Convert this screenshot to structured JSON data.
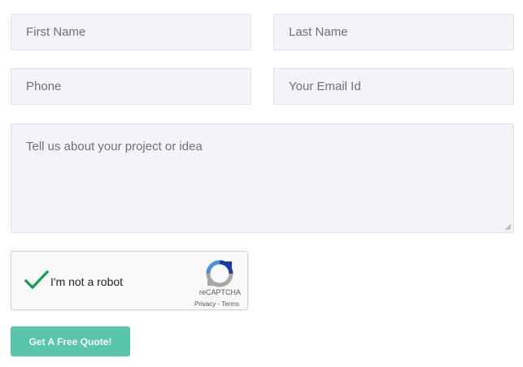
{
  "form": {
    "first_name_placeholder": "First Name",
    "last_name_placeholder": "Last Name",
    "phone_placeholder": "Phone",
    "email_placeholder": "Your Email Id",
    "message_placeholder": "Tell us about your project or idea"
  },
  "recaptcha": {
    "label": "I'm not a robot",
    "brand": "reCAPTCHA",
    "privacy_link": "Privacy",
    "separator": " - ",
    "terms_link": "Terms",
    "checked": true,
    "check_color": "#0f9d58",
    "icons": [
      "checkmark-icon",
      "recaptcha-logo-icon"
    ]
  },
  "submit": {
    "label": "Get A Free Quote!",
    "color": "#5ac5ad"
  },
  "colors": {
    "field_background": "#f4f3f8",
    "placeholder_text": "#6f6e7a"
  }
}
